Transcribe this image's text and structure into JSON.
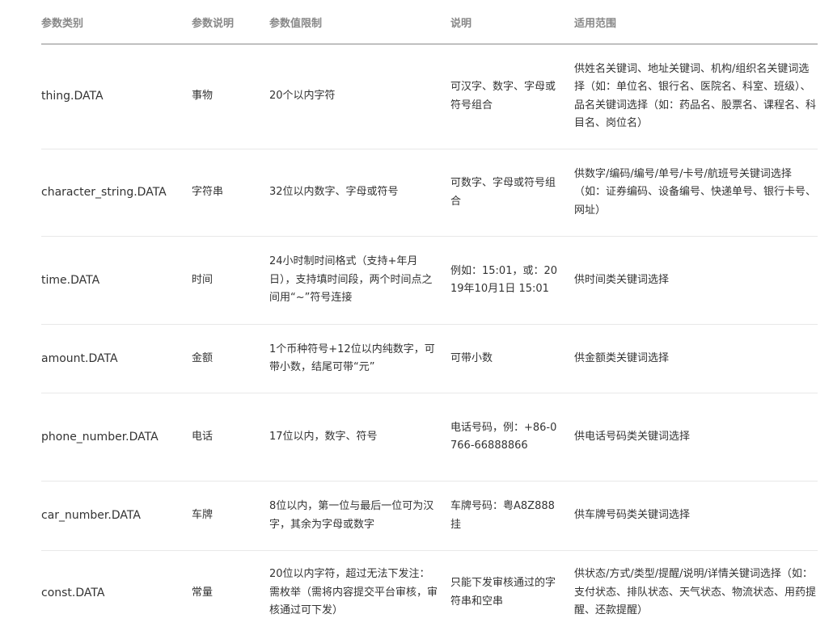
{
  "table": {
    "headers": [
      "参数类别",
      "参数说明",
      "参数值限制",
      "说明",
      "适用范围"
    ],
    "rows": [
      {
        "key": "thing.DATA",
        "desc": "事物",
        "limit": "20个以内字符",
        "note": "可汉字、数字、字母或符号组合",
        "scope": "供姓名关键词、地址关键词、机构/组织名关键词选择（如：单位名、银行名、医院名、科室、班级）、品名关键词选择（如：药品名、股票名、课程名、科目名、岗位名）"
      },
      {
        "key": "character_string.DATA",
        "desc": "字符串",
        "limit": "32位以内数字、字母或符号",
        "note": "可数字、字母或符号组合",
        "scope": "供数字/编码/编号/单号/卡号/航班号关键词选择（如：证券编码、设备编号、快递单号、银行卡号、网址）"
      },
      {
        "key": "time.DATA",
        "desc": "时间",
        "limit": "24小时制时间格式（支持+年月日），支持填时间段，两个时间点之间用“~”符号连接",
        "note": "例如：15:01，或：2019年10月1日 15:01",
        "scope": "供时间类关键词选择"
      },
      {
        "key": "amount.DATA",
        "desc": "金额",
        "limit": "1个币种符号+12位以内纯数字，可带小数，结尾可带“元”",
        "note": "可带小数",
        "scope": "供金额类关键词选择"
      },
      {
        "key": "phone_number.DATA",
        "desc": "电话",
        "limit": "17位以内，数字、符号",
        "note": "电话号码，例：+86-0766-66888866",
        "scope": "供电话号码类关键词选择"
      },
      {
        "key": "car_number.DATA",
        "desc": "车牌",
        "limit": "8位以内，第一位与最后一位可为汉字，其余为字母或数字",
        "note": "车牌号码：粤A8Z888挂",
        "scope": "供车牌号码类关键词选择"
      },
      {
        "key": "const.DATA",
        "desc": "常量",
        "limit": "20位以内字符，超过无法下发注：需枚举（需将内容提交平台审核，审核通过可下发）",
        "note": "只能下发审核通过的字符串和空串",
        "scope": "供状态/方式/类型/提醒/说明/详情关键词选择（如：支付状态、排队状态、天气状态、物流状态、用药提醒、还款提醒）"
      }
    ]
  }
}
